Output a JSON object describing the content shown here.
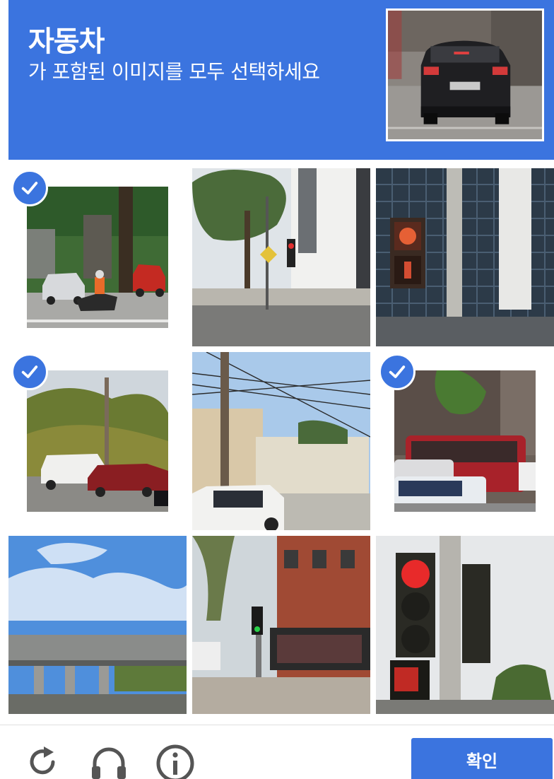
{
  "header": {
    "keyword": "자동차",
    "instruction": "가 포함된 이미지를 모두 선택하세요",
    "background": "#3b74df",
    "sample_image": "rear-of-black-hatchback-car"
  },
  "grid": {
    "rows": 3,
    "cols": 3,
    "tiles": [
      {
        "scene": "street-with-tree-white-car-red-suv-motorbike",
        "selected": true
      },
      {
        "scene": "street-corner-building-traffic-light",
        "selected": false
      },
      {
        "scene": "pedestrian-signal-glass-building",
        "selected": false
      },
      {
        "scene": "parked-white-van-red-suv-trees",
        "selected": true
      },
      {
        "scene": "power-lines-building-white-suv",
        "selected": false
      },
      {
        "scene": "red-bus-and-white-cars",
        "selected": true
      },
      {
        "scene": "highway-overpass-blue-sky",
        "selected": false
      },
      {
        "scene": "traffic-lights-brick-shop-front",
        "selected": false
      },
      {
        "scene": "red-traffic-light-on-pole",
        "selected": false
      }
    ]
  },
  "footer": {
    "reload_icon": "reload-icon",
    "audio_icon": "headphones-icon",
    "info_icon": "info-icon",
    "verify_label": "확인"
  },
  "colors": {
    "accent": "#3b74df",
    "icon_gray": "#555555"
  }
}
